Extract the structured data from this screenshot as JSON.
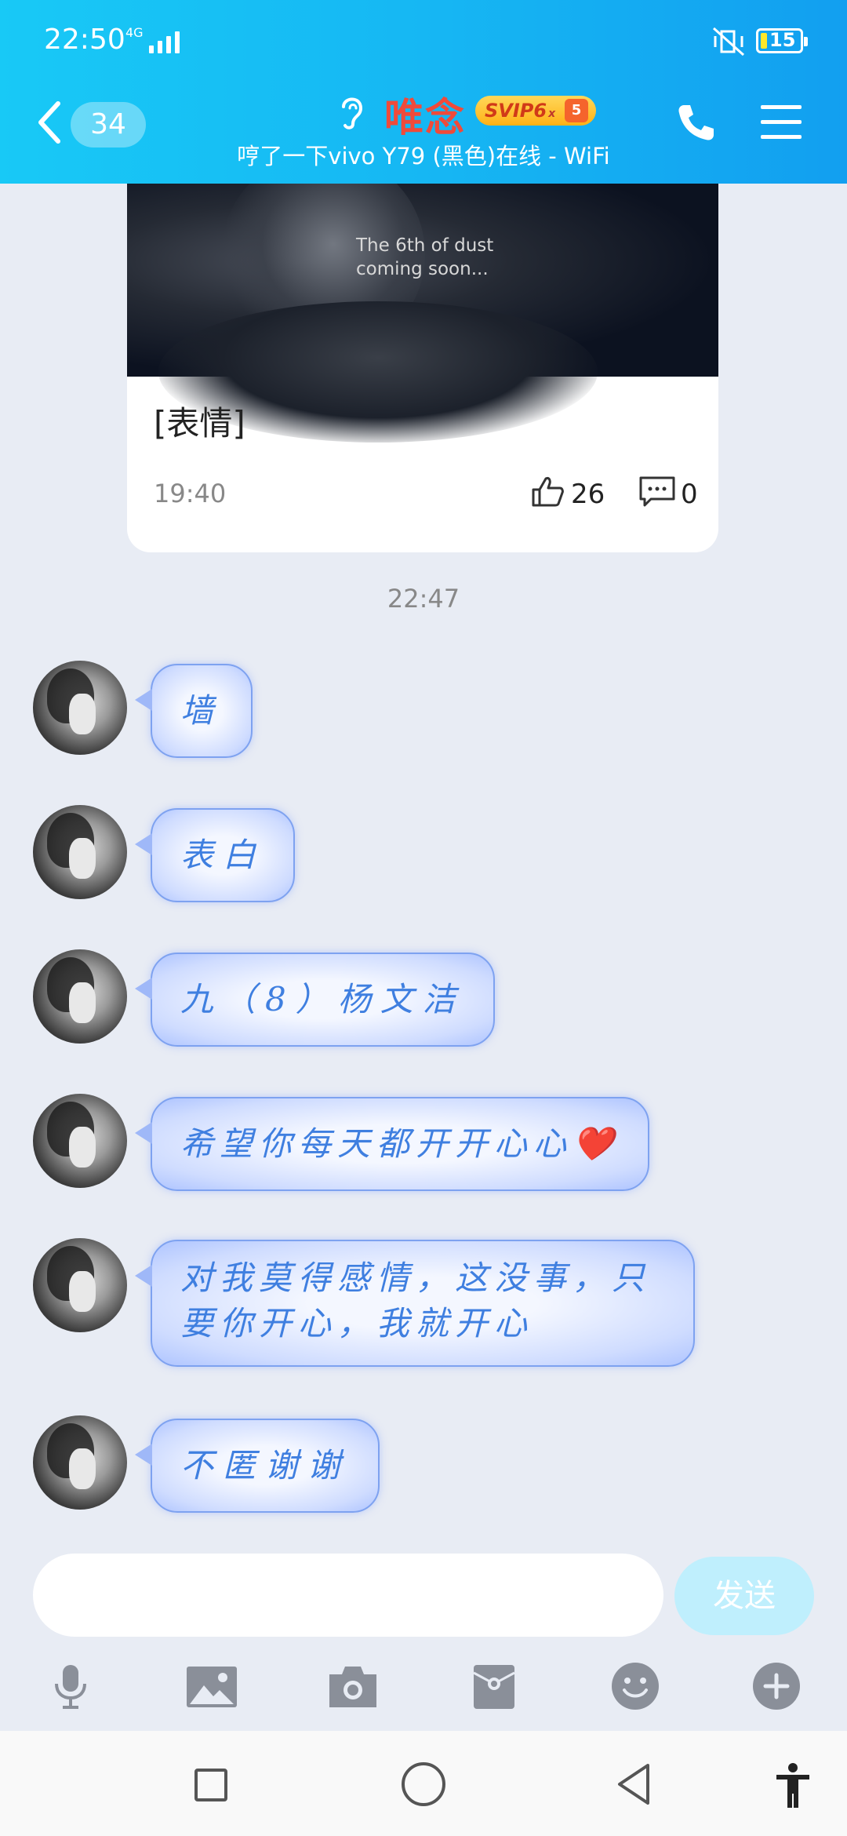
{
  "status_bar": {
    "time": "22:50",
    "network": "4G",
    "battery": "15"
  },
  "header": {
    "unread_count": "34",
    "contact_name": "唯念",
    "svip_label": "SVIP6",
    "svip_multiplier": "x",
    "svip_level": "5",
    "online_status": "哼了一下vivo Y79 (黑色)在线 - WiFi"
  },
  "card": {
    "image_caption_line1": "The 6th of dust",
    "image_caption_line2": "coming soon...",
    "text": "[表情]",
    "time": "19:40",
    "likes": "26",
    "comments": "0"
  },
  "time_separator": "22:47",
  "messages": [
    {
      "text": "墙"
    },
    {
      "text": "表白"
    },
    {
      "text": "九（8）杨文洁"
    },
    {
      "text": "希望你每天都开开心心❤️"
    },
    {
      "line1": "对我莫得感情，这没事，只",
      "line2": "要你开心，我就开心"
    },
    {
      "text": "不匿谢谢"
    }
  ],
  "input": {
    "placeholder": "",
    "send_label": "发送"
  },
  "toolbar": {
    "icons": [
      "microphone-icon",
      "image-icon",
      "camera-icon",
      "red-packet-icon",
      "emoji-icon",
      "plus-icon"
    ]
  },
  "colors": {
    "header_gradient_start": "#18c9f6",
    "header_gradient_end": "#129ff0",
    "bubble_text": "#3f7fe0",
    "contact_name": "#f04a3a",
    "send_button": "#bfeffd",
    "background": "#e8ecf4"
  }
}
